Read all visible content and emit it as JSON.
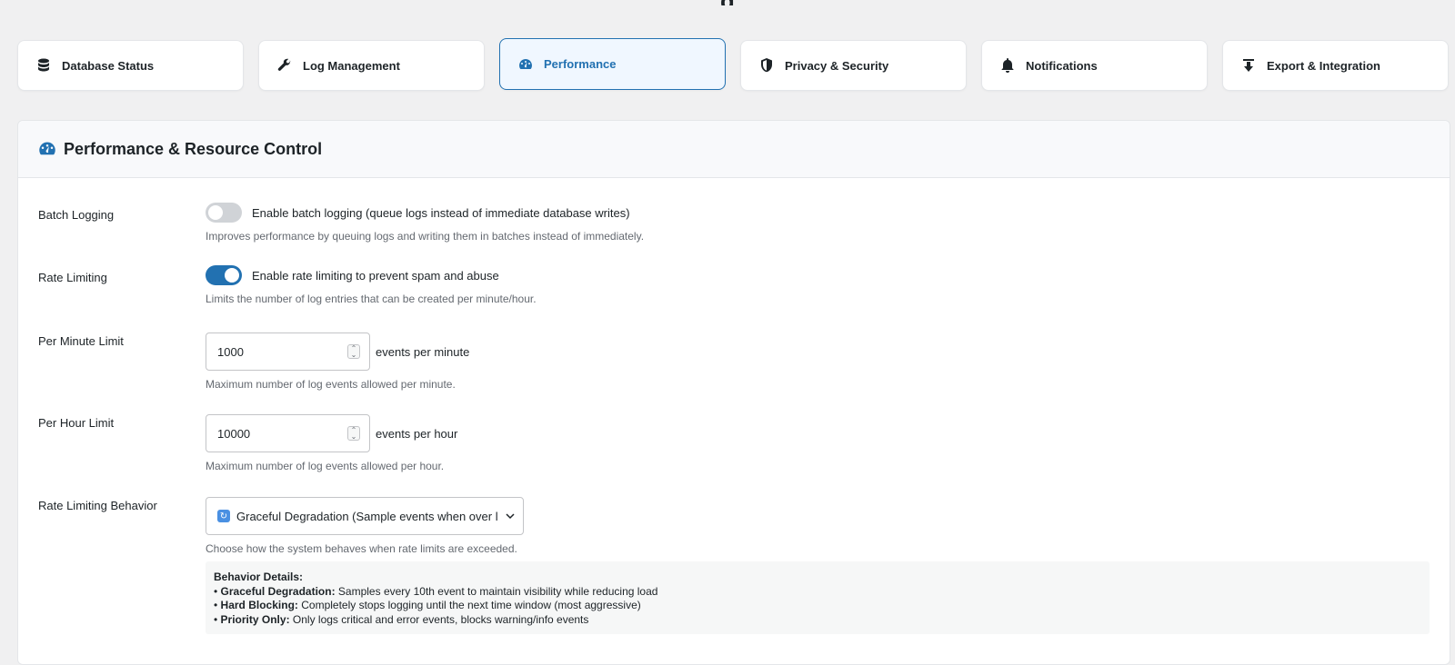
{
  "page_title_fragment": "g",
  "tabs": [
    {
      "label": "Database Status",
      "icon": "database-icon"
    },
    {
      "label": "Log Management",
      "icon": "wrench-icon"
    },
    {
      "label": "Performance",
      "icon": "dashboard-icon",
      "active": true
    },
    {
      "label": "Privacy & Security",
      "icon": "shield-icon"
    },
    {
      "label": "Notifications",
      "icon": "bell-icon"
    },
    {
      "label": "Export & Integration",
      "icon": "download-icon"
    }
  ],
  "panel": {
    "title": "Performance & Resource Control",
    "batch_logging": {
      "label": "Batch Logging",
      "toggle_text": "Enable batch logging (queue logs instead of immediate database writes)",
      "enabled": false,
      "description": "Improves performance by queuing logs and writing them in batches instead of immediately."
    },
    "rate_limiting": {
      "label": "Rate Limiting",
      "toggle_text": "Enable rate limiting to prevent spam and abuse",
      "enabled": true,
      "description": "Limits the number of log entries that can be created per minute/hour."
    },
    "per_minute": {
      "label": "Per Minute Limit",
      "value": "1000",
      "suffix": "events per minute",
      "description": "Maximum number of log events allowed per minute."
    },
    "per_hour": {
      "label": "Per Hour Limit",
      "value": "10000",
      "suffix": "events per hour",
      "description": "Maximum number of log events allowed per hour."
    },
    "behavior": {
      "label": "Rate Limiting Behavior",
      "selected": "Graceful Degradation (Sample events when over limit)",
      "description": "Choose how the system behaves when rate limits are exceeded.",
      "details_title": "Behavior Details:",
      "details": [
        {
          "name": "Graceful Degradation:",
          "text": "Samples every 10th event to maintain visibility while reducing load"
        },
        {
          "name": "Hard Blocking:",
          "text": "Completely stops logging until the next time window (most aggressive)"
        },
        {
          "name": "Priority Only:",
          "text": "Only logs critical and error events, blocks warning/info events"
        }
      ]
    }
  },
  "colors": {
    "accent": "#2271b1",
    "toggle_off": "#d0d3d7",
    "background": "#f0f0f1"
  }
}
